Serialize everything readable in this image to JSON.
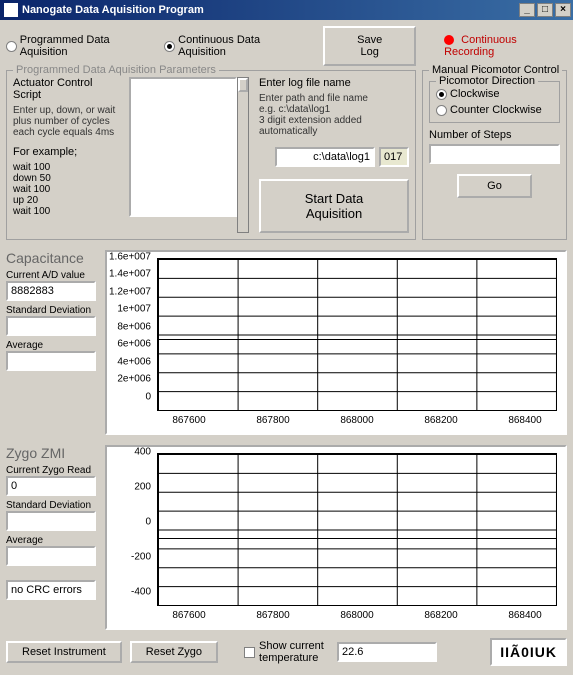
{
  "window": {
    "title": "Nanogate Data Aquisition Program",
    "buttons": {
      "min": "_",
      "max": "□",
      "close": "×"
    }
  },
  "mode": {
    "programmed_label": "Programmed Data Aquisition",
    "continuous_label": "Continuous Data Aquisition",
    "selected": "continuous"
  },
  "save_log_btn": "Save Log",
  "recording_label": "Continuous Recording",
  "params": {
    "legend": "Programmed Data Aquisition Parameters",
    "script_title": "Actuator Control Script",
    "script_help1": "Enter up, down, or wait",
    "script_help2": "plus number of cycles",
    "script_help3": "each cycle equals 4ms",
    "script_example_hdr": "For example;",
    "script_example": "wait 100\ndown 50\nwait 100\nup 20\nwait 100",
    "log_title": "Enter log file name",
    "log_help1": "Enter path and file name",
    "log_help2": "e.g. c:\\data\\log1",
    "log_help3": "3 digit extension added automatically",
    "log_path": "c:\\data\\log1",
    "log_ext": "017",
    "start_btn": "Start Data Aquisition"
  },
  "manual": {
    "legend": "Manual Picomotor Control",
    "dir_legend": "Picomotor Direction",
    "cw_label": "Clockwise",
    "ccw_label": "Counter Clockwise",
    "steps_label": "Number of Steps",
    "steps_value": "",
    "go_btn": "Go"
  },
  "capacitance": {
    "title": "Capacitance",
    "ad_label": "Current A/D value",
    "ad_value": "8882883",
    "std_label": "Standard Deviation",
    "std_value": "",
    "avg_label": "Average",
    "avg_value": ""
  },
  "zygo": {
    "title": "Zygo ZMI",
    "read_label": "Current Zygo Read",
    "read_value": "0",
    "std_label": "Standard Deviation",
    "std_value": "",
    "avg_label": "Average",
    "avg_value": "",
    "crc_label": "no CRC errors"
  },
  "chart_data": [
    {
      "type": "line",
      "title": "",
      "xlabel": "",
      "ylabel": "",
      "xticks": [
        "867600",
        "867800",
        "868000",
        "868200",
        "868400"
      ],
      "yticks": [
        "0",
        "2e+006",
        "4e+006",
        "6e+006",
        "8e+006",
        "1e+007",
        "1.2e+007",
        "1.4e+007",
        "1.6e+007"
      ],
      "ylim": [
        0,
        16000000
      ],
      "series": [
        {
          "name": "capacitance",
          "approx_const_value": 8800000
        }
      ]
    },
    {
      "type": "line",
      "title": "",
      "xlabel": "",
      "ylabel": "",
      "xticks": [
        "867600",
        "867800",
        "868000",
        "868200",
        "868400"
      ],
      "yticks": [
        "-400",
        "-200",
        "0",
        "200",
        "400"
      ],
      "ylim": [
        -500,
        500
      ],
      "series": [
        {
          "name": "zygo",
          "approx_const_value": 0
        }
      ]
    }
  ],
  "bottom": {
    "reset_instr": "Reset Instrument",
    "reset_zygo": "Reset Zygo",
    "show_temp_label": "Show current temperature",
    "temp_value": "22.6",
    "status_code": "IIÃ0IUK"
  }
}
